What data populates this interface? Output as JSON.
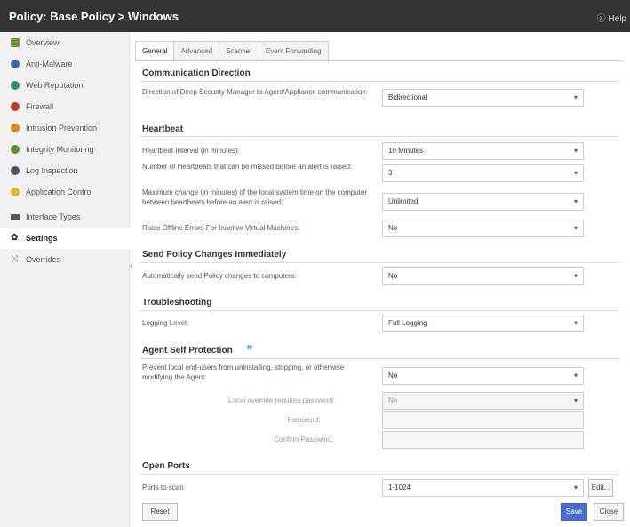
{
  "header": {
    "title": "Policy: Base Policy > Windows",
    "help": "ⓧ Help"
  },
  "sidebar": {
    "items": [
      {
        "label": "Overview",
        "color": "#6b9a3a"
      },
      {
        "label": "Anti-Malware",
        "color": "#3a66b0"
      },
      {
        "label": "Web Reputation",
        "color": "#2e8f6a"
      },
      {
        "label": "Firewall",
        "color": "#c0392b"
      },
      {
        "label": "Intrusion Prevention",
        "color": "#d68a1e"
      },
      {
        "label": "Integrity Monitoring",
        "color": "#5f8f2e"
      },
      {
        "label": "Log Inspection",
        "color": "#40556b"
      },
      {
        "label": "Application Control",
        "color": "#e2b72a"
      },
      {
        "label": "Interface Types",
        "color": "#555555"
      },
      {
        "label": "Settings",
        "color": "#333333"
      },
      {
        "label": "Overrides",
        "color": "#777777"
      }
    ],
    "active": "Settings",
    "collapse": "‹"
  },
  "tabs": [
    {
      "label": "General"
    },
    {
      "label": "Advanced"
    },
    {
      "label": "Scanner"
    },
    {
      "label": "Event Forwarding"
    }
  ],
  "sections": {
    "communication": {
      "title": "Communication Direction",
      "direction_label": "Direction of Deep Security Manager to Agent/Appliance communication:",
      "direction_value": "Bidirectional"
    },
    "heartbeat": {
      "title": "Heartbeat",
      "interval_label": "Heartbeat Interval (in minutes):",
      "interval_value": "10 Minutes",
      "missed_label": "Number of Heartbeats that can be missed before an alert is raised:",
      "missed_value": "3",
      "clock_label": "Maximum change (in minutes) of the local system time on the computer between heartbeats before an alert is raised:",
      "clock_value": "Unlimited",
      "offline_label": "Raise Offline Errors For Inactive Virtual Machines:",
      "offline_value": "No"
    },
    "send_policy": {
      "title": "Send Policy Changes Immediately",
      "auto_label": "Automatically send Policy changes to computers:",
      "auto_value": "No"
    },
    "troubleshooting": {
      "title": "Troubleshooting",
      "logging_label": "Logging Level:",
      "logging_value": "Full Logging"
    },
    "self_protection": {
      "title": "Agent Self Protection",
      "info_icon": "⌗",
      "prevent_label": "Prevent local end-users from uninstalling, stopping, or otherwise modifying the Agent:",
      "prevent_value": "No",
      "override_label": "Local override requires password:",
      "override_value": "No",
      "password_label": "Password:",
      "confirm_label": "Confirm Password:"
    },
    "open_ports": {
      "title": "Open Ports",
      "scan_label": "Ports to scan:",
      "scan_value": "1-1024",
      "edit_label": "Edit..."
    }
  },
  "footer": {
    "reset": "Reset",
    "save": "Save",
    "close": "Close"
  },
  "chevron": "▾"
}
